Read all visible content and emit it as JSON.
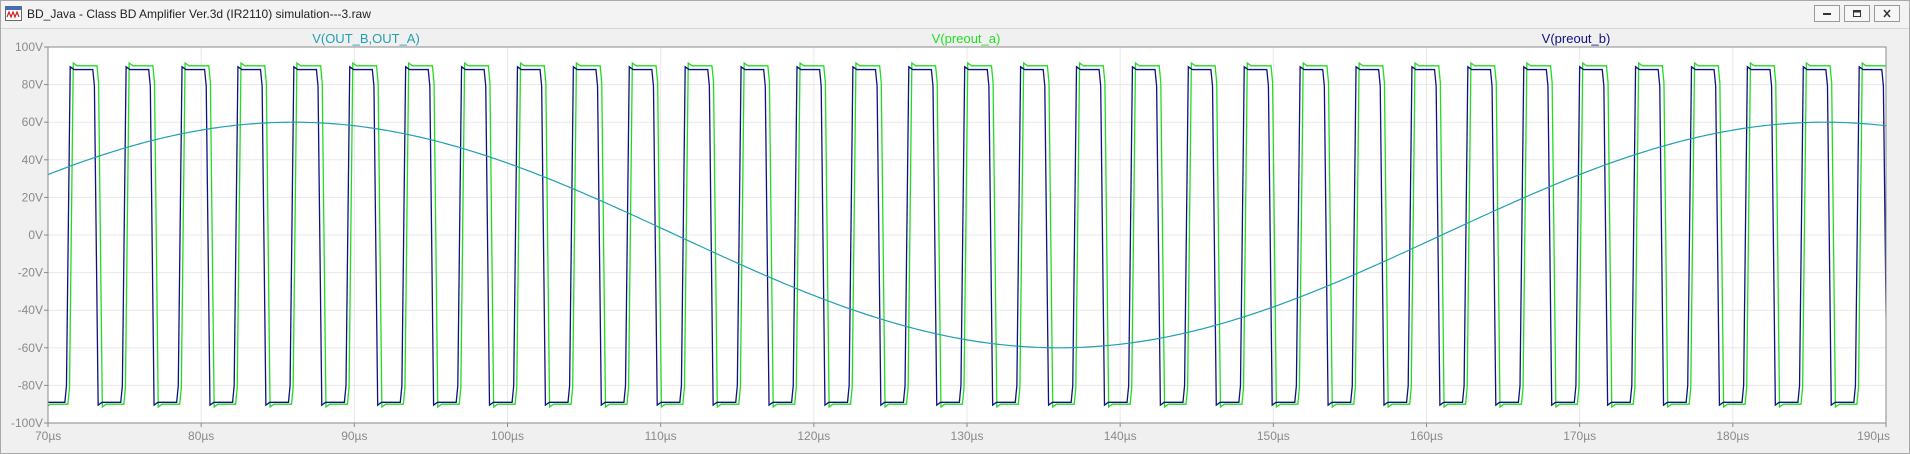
{
  "window": {
    "title": "BD_Java - Class BD Amplifier Ver.3d (IR2110) simulation---3.raw",
    "icon": "ltspice-waveform-icon",
    "buttons": [
      "minimize-icon",
      "restore-icon",
      "close-icon"
    ]
  },
  "chart_data": {
    "type": "line",
    "x_unit": "µs",
    "xlim": [
      70,
      190
    ],
    "ylim": [
      -100,
      100
    ],
    "x_ticks": [
      70,
      80,
      90,
      100,
      110,
      120,
      130,
      140,
      150,
      160,
      170,
      180,
      190
    ],
    "x_tick_labels": [
      "70µs",
      "80µs",
      "90µs",
      "100µs",
      "110µs",
      "120µs",
      "130µs",
      "140µs",
      "150µs",
      "160µs",
      "170µs",
      "180µs",
      "190µs"
    ],
    "y_ticks": [
      100,
      80,
      60,
      40,
      20,
      0,
      -20,
      -40,
      -60,
      -80,
      -100
    ],
    "y_tick_labels": [
      "100V",
      "80V",
      "60V",
      "40V",
      "20V",
      "0V",
      "-20V",
      "-40V",
      "-60V",
      "-80V",
      "-100V"
    ],
    "grid": true,
    "background": "#ffffff",
    "axis_color": "#8a8a8a",
    "series": [
      {
        "name": "V(OUT_B,OUT_A)",
        "color": "#1f9fb0",
        "kind": "sine",
        "amplitude": 60,
        "period_us": 100,
        "peak_at_us": 86,
        "sample_points": [
          [
            70,
            33
          ],
          [
            80,
            55
          ],
          [
            86,
            60
          ],
          [
            95,
            52
          ],
          [
            110,
            3
          ],
          [
            120,
            -30
          ],
          [
            130,
            -56
          ],
          [
            136,
            -60
          ],
          [
            145,
            -50
          ],
          [
            160,
            -15
          ],
          [
            170,
            25
          ],
          [
            180,
            55
          ],
          [
            185,
            60
          ],
          [
            190,
            58
          ]
        ]
      },
      {
        "name": "V(preout_a)",
        "color": "#22dd22",
        "kind": "square",
        "high": 90,
        "low": -90,
        "period_us": 3.65,
        "first_rise_us": 71.3,
        "duty": 0.52
      },
      {
        "name": "V(preout_b)",
        "color": "#101080",
        "kind": "square",
        "high": 88,
        "low": -89,
        "period_us": 3.65,
        "first_rise_us": 71.1,
        "duty": 0.5
      }
    ]
  }
}
